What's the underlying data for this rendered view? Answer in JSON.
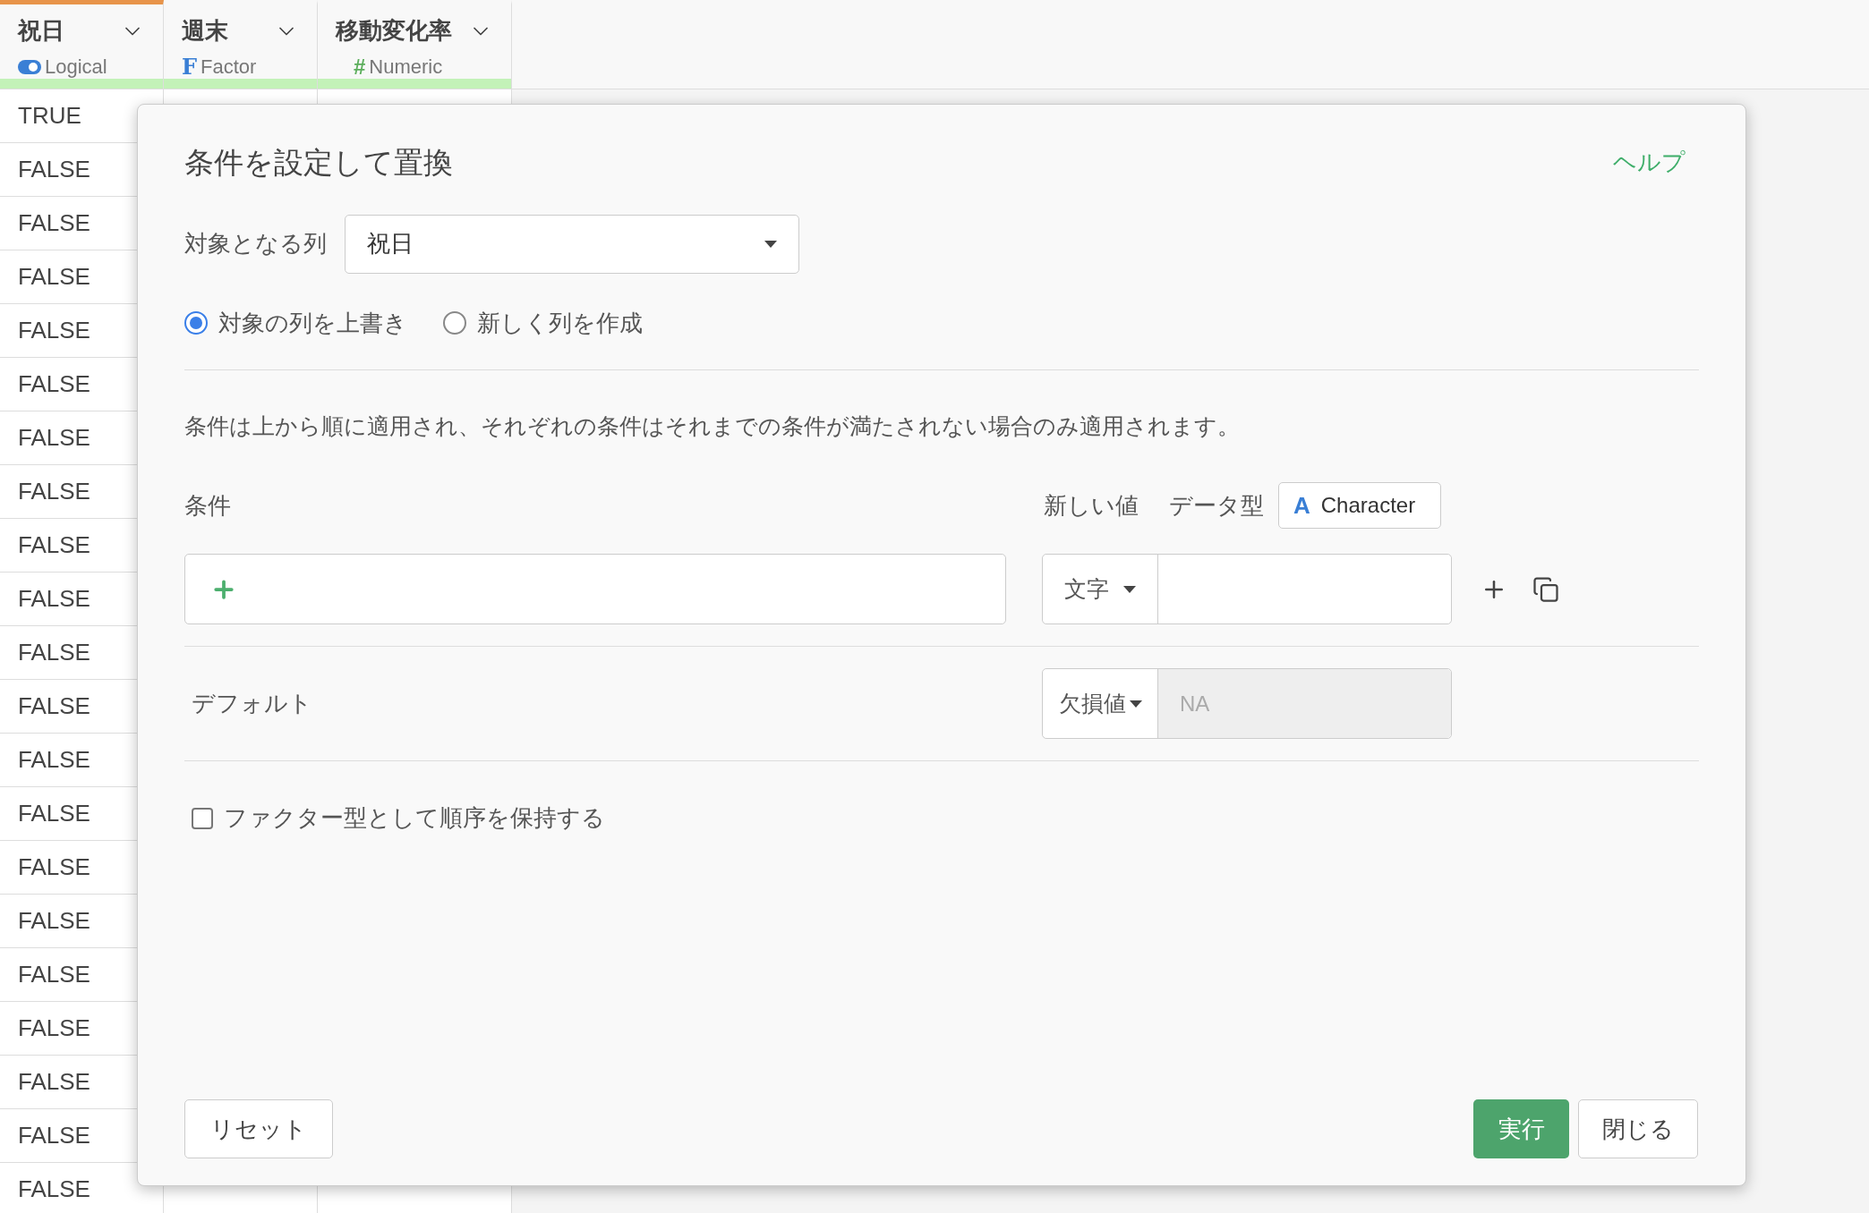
{
  "columns": [
    {
      "name": "祝日",
      "kind": "logical",
      "type": "Logical",
      "selected": true
    },
    {
      "name": "週末",
      "kind": "factor",
      "type_icon": "F",
      "type": "Factor",
      "selected": false
    },
    {
      "name": "移動変化率",
      "kind": "numeric",
      "type_icon": "#",
      "type": "Numeric",
      "selected": false
    }
  ],
  "rows": [
    [
      "TRUE"
    ],
    [
      "FALSE"
    ],
    [
      "FALSE"
    ],
    [
      "FALSE"
    ],
    [
      "FALSE"
    ],
    [
      "FALSE"
    ],
    [
      "FALSE"
    ],
    [
      "FALSE"
    ],
    [
      "FALSE"
    ],
    [
      "FALSE"
    ],
    [
      "FALSE"
    ],
    [
      "FALSE"
    ],
    [
      "FALSE"
    ],
    [
      "FALSE"
    ],
    [
      "FALSE"
    ],
    [
      "FALSE"
    ],
    [
      "FALSE"
    ],
    [
      "FALSE"
    ],
    [
      "FALSE"
    ],
    [
      "FALSE"
    ],
    [
      "FALSE"
    ]
  ],
  "dialog": {
    "title": "条件を設定して置換",
    "help_link": "ヘルプ",
    "target_column": {
      "label": "対象となる列",
      "value": "祝日"
    },
    "output_options": [
      {
        "label": "対象の列を上書き",
        "selected": true
      },
      {
        "label": "新しく列を作成",
        "selected": false
      }
    ],
    "description": "条件は上から順に適用され、それぞれの条件はそれまでの条件が満たされない場合のみ適用されます。",
    "conditions": {
      "label": "条件",
      "new_value_label": "新しい値",
      "data_type_label": "データ型",
      "data_type_icon": "A",
      "data_type": "Character",
      "rows": [
        {
          "value_type": "文字"
        }
      ]
    },
    "default": {
      "label": "デフォルト",
      "value_type": "欠損値",
      "value": "NA",
      "disabled": true
    },
    "keep_factor_order": {
      "label": "ファクター型として順序を保持する",
      "checked": false
    },
    "buttons": {
      "reset": "リセット",
      "run": "実行",
      "close": "閉じる"
    }
  }
}
